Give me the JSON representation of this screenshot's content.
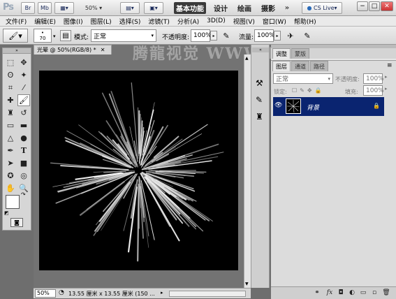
{
  "app": {
    "logo": "Ps",
    "zoom_select": "50%",
    "workspaces": [
      "基本功能",
      "设计",
      "绘画",
      "摄影"
    ],
    "cs_live": "CS Live",
    "window_buttons": [
      "−",
      "□",
      "✕"
    ]
  },
  "menu": [
    "文件(F)",
    "编辑(E)",
    "图像(I)",
    "图层(L)",
    "选择(S)",
    "滤镜(T)",
    "分析(A)",
    "3D(D)",
    "视图(V)",
    "窗口(W)",
    "帮助(H)"
  ],
  "options": {
    "brush_size": "70",
    "mode_label": "模式:",
    "mode_value": "正常",
    "opacity_label": "不透明度:",
    "opacity_value": "100%",
    "flow_label": "流量:",
    "flow_value": "100%"
  },
  "document": {
    "tab_title": "光晕 @ 50%(RGB/8) *",
    "status_zoom": "50%",
    "status_info": "13.55 厘米 x 13.55 厘米 (150 ..."
  },
  "panel": {
    "tabs": [
      "调整",
      "蒙版"
    ],
    "layer_tabs": [
      "图层",
      "通道",
      "路径"
    ],
    "blend_mode": "正常",
    "opacity_label": "不透明度:",
    "opacity_value": "100%",
    "lock_label": "锁定:",
    "fill_label": "填充:",
    "fill_value": "100%",
    "layer_name": "背景"
  },
  "watermark": "腾龍视觉 WWW.LVI.NET",
  "colors": {
    "accent": "#0a2470",
    "canvas": "#000000",
    "workspace_active": "#3a3a3a"
  }
}
